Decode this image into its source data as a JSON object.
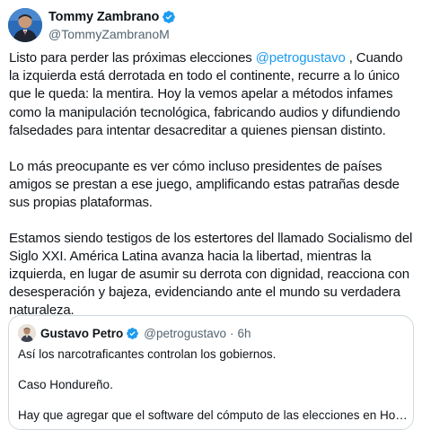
{
  "author": {
    "display_name": "Tommy Zambrano",
    "handle": "@TommyZambranoM",
    "verified": true,
    "avatar_icon": "profile-photo",
    "verified_color": "#1d9bf0"
  },
  "tweet": {
    "p1_before": "Listo para perder las próximas elecciones ",
    "p1_mention": "@petrogustavo",
    "p1_after": " , Cuando la izquierda está derrotada en todo el continente, recurre a lo único que le queda: la mentira. Hoy la vemos apelar a métodos infames como la manipulación tecnológica, fabricando audios y difundiendo falsedades para intentar desacreditar a quienes piensan distinto.",
    "p2": "Lo más preocupante es ver cómo incluso presidentes de países amigos se prestan a ese juego, amplificando estas patrañas desde sus propias plataformas.",
    "p3": "Estamos siendo testigos de los estertores del llamado Socialismo del Siglo XXI. América Latina avanza hacia la libertad, mientras la izquierda, en lugar de asumir su derrota con dignidad, reacciona con desesperación y bajeza, evidenciando ante el mundo su verdadera naturaleza."
  },
  "quoted_tweet": {
    "display_name": "Gustavo Petro",
    "handle": "@petrogustavo",
    "separator": "·",
    "time": "6h",
    "verified": true,
    "lines": [
      "Así los narcotraficantes controlan los gobiernos.",
      "Caso Hondureño.",
      "Hay que agregar que el software del cómputo de las elecciones en Honduras ..."
    ]
  },
  "colors": {
    "mention": "#1d9bf0",
    "secondary_text": "#536471",
    "border": "#cfd9de"
  }
}
